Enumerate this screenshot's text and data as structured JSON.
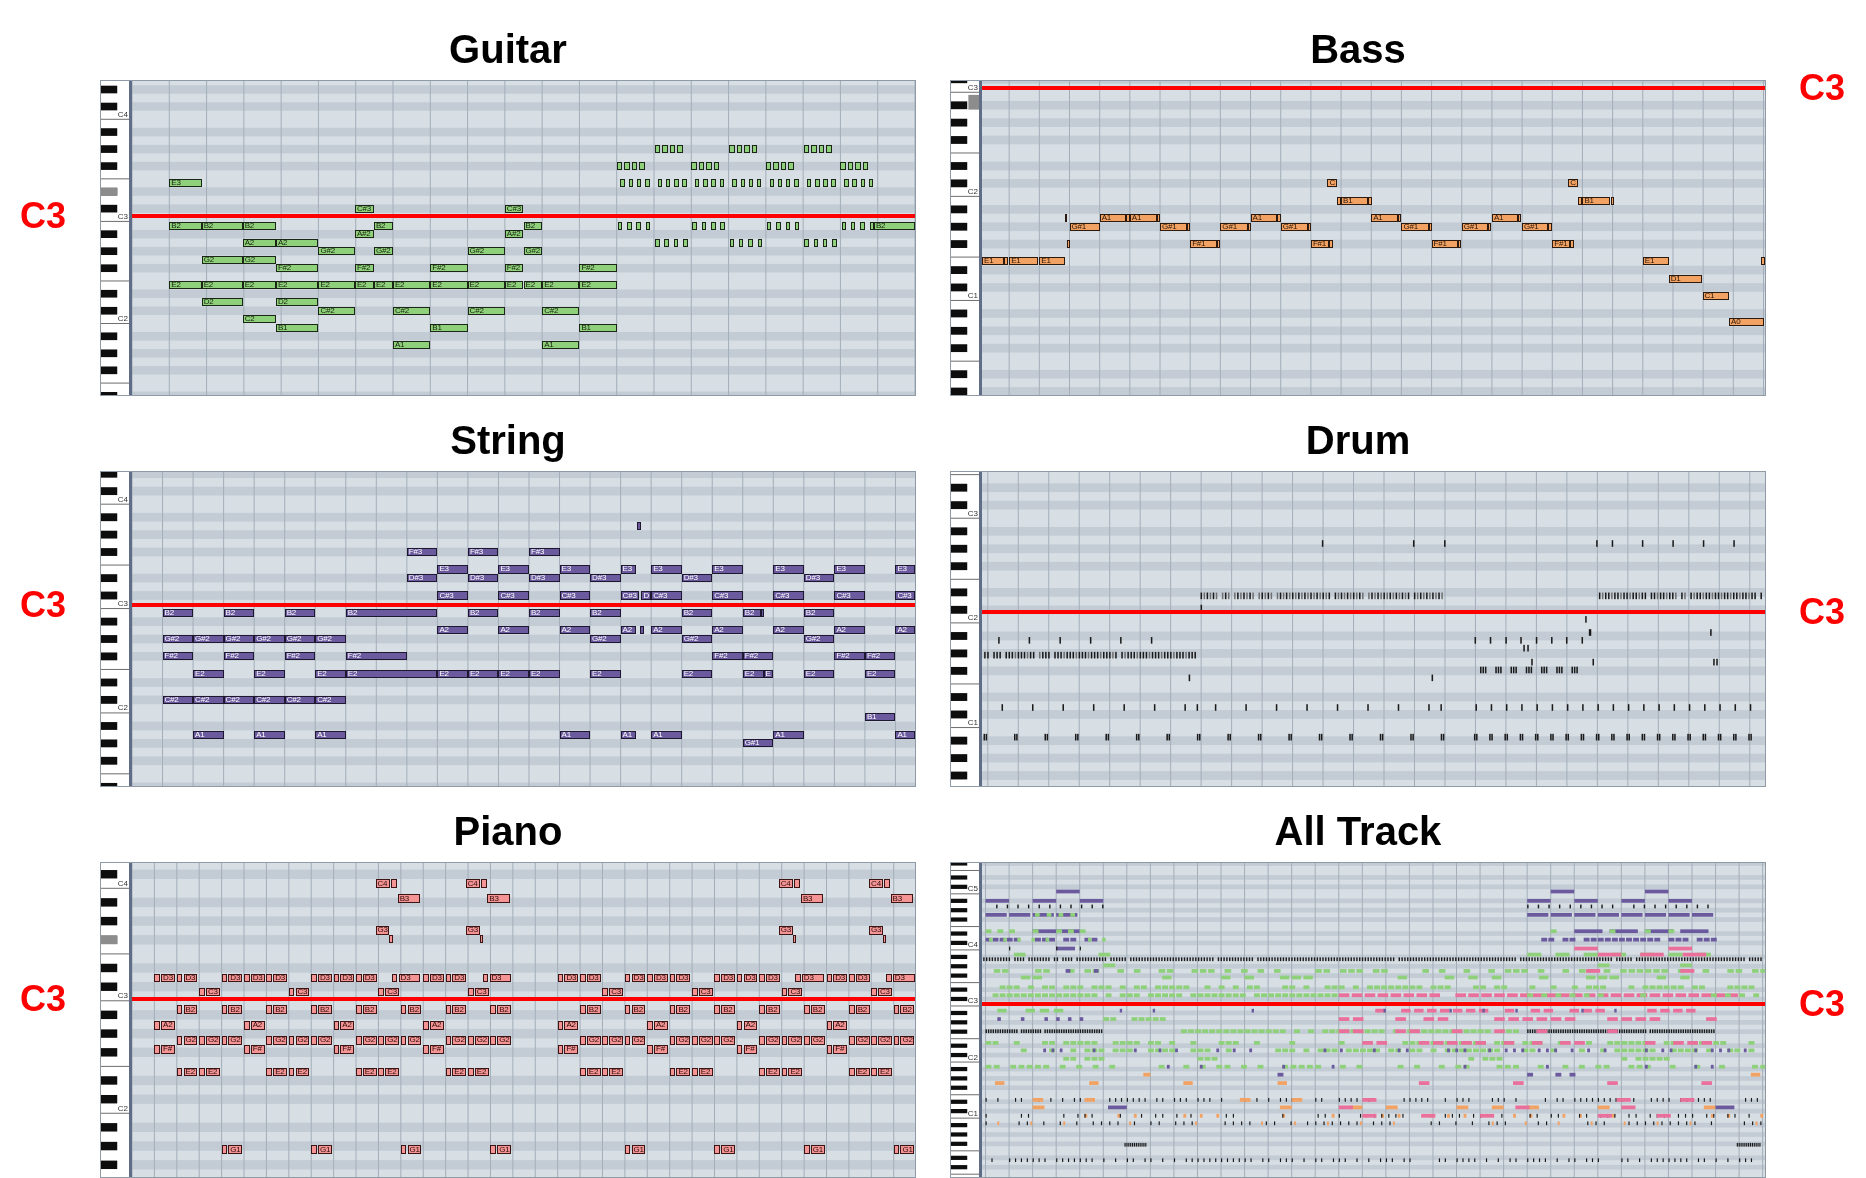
{
  "panels": [
    {
      "title": "Guitar",
      "marker": "C3",
      "octave_labels": [
        "C4",
        "C3",
        "C2"
      ],
      "note_rows": [
        {
          "notes": [
            "E3"
          ]
        },
        {
          "notes": [
            "C#3",
            "C#3"
          ]
        },
        {
          "notes": [
            "B2",
            "B2",
            "B2",
            "B2",
            "B2",
            "B2"
          ]
        },
        {
          "notes": [
            "A#2",
            "A#2"
          ]
        },
        {
          "notes": [
            "A2",
            "A2"
          ]
        },
        {
          "notes": [
            "G#2",
            "G#2",
            "G#2",
            "G#2"
          ]
        },
        {
          "notes": [
            "G2",
            "G2"
          ]
        },
        {
          "notes": [
            "F#2",
            "F#2",
            "F#2",
            "F#2",
            "F#2"
          ]
        },
        {
          "notes": [
            "E2",
            "E2",
            "E2",
            "E2",
            "E2",
            "E2",
            "E2",
            "E2",
            "E2",
            "E2",
            "E2",
            "E2",
            "E2",
            "E2"
          ]
        },
        {
          "notes": [
            "D2",
            "D2"
          ]
        },
        {
          "notes": [
            "C#2",
            "C#2",
            "C#2",
            "C#2"
          ]
        },
        {
          "notes": [
            "C2"
          ]
        },
        {
          "notes": [
            "B1",
            "B1",
            "B1"
          ]
        },
        {
          "notes": [
            "A1",
            "A1"
          ]
        }
      ]
    },
    {
      "title": "Bass",
      "marker": "C3",
      "octave_labels": [
        "C3",
        "C2",
        "C1"
      ],
      "note_rows": [
        {
          "notes": [
            "C",
            "C"
          ]
        },
        {
          "notes": [
            "B1",
            "B1"
          ]
        },
        {
          "notes": [
            "A1",
            "A1",
            "A1",
            "A1",
            "A1"
          ]
        },
        {
          "notes": [
            "G#1",
            "G#1",
            "G#1",
            "G#1",
            "G#1",
            "G#1",
            "G#1"
          ]
        },
        {
          "notes": [
            "F#1",
            "F#1",
            "F#1",
            "F#1"
          ]
        },
        {
          "notes": [
            "E1",
            "E1",
            "E1",
            "E1"
          ]
        },
        {
          "notes": [
            "D1"
          ]
        },
        {
          "notes": [
            "C1"
          ]
        },
        {
          "notes": [
            "A0"
          ]
        }
      ]
    },
    {
      "title": "String",
      "marker": "C3",
      "octave_labels": [
        "C4",
        "C3",
        "C2"
      ],
      "note_rows": [
        {
          "notes": [
            "F#3",
            "F#3",
            "F#3"
          ]
        },
        {
          "notes": [
            "E3",
            "E3",
            "E3",
            "E3",
            "E3",
            "E3",
            "E3",
            "E3",
            "E3"
          ]
        },
        {
          "notes": [
            "D#3",
            "D#3",
            "D#3",
            "D#3",
            "D#3",
            "D#3"
          ]
        },
        {
          "notes": [
            "C#3",
            "C#3",
            "C#3",
            "C#3",
            "D",
            "C#3",
            "C#3",
            "C#3",
            "C#3",
            "C#3"
          ]
        },
        {
          "notes": [
            "B2",
            "B2",
            "B2",
            "B2",
            "B2",
            "B2",
            "B2",
            "B2",
            "B2",
            "B2"
          ]
        },
        {
          "notes": [
            "A2",
            "A2",
            "A2",
            "A2",
            "A2",
            "A2",
            "A2",
            "A2",
            "A2"
          ]
        },
        {
          "notes": [
            "G#2",
            "G#2",
            "G#2",
            "G#2",
            "G#2",
            "G#2",
            "G#2",
            "G#2",
            "G#2"
          ]
        },
        {
          "notes": [
            "F#2",
            "F#2",
            "F#2",
            "F#2",
            "F#2",
            "F#2",
            "F#2",
            "F#2"
          ]
        },
        {
          "notes": [
            "E2",
            "E2",
            "E2",
            "E2",
            "E2",
            "E2",
            "E2",
            "E2",
            "E2",
            "E2",
            "E2",
            "E",
            "E2",
            "E2"
          ]
        },
        {
          "notes": [
            "C#2",
            "C#2",
            "C#2",
            "C#2",
            "C#2",
            "C#2"
          ]
        },
        {
          "notes": [
            "B1"
          ]
        },
        {
          "notes": [
            "A1",
            "A1",
            "A1",
            "A1",
            "A1",
            "A1",
            "A1",
            "A1"
          ]
        },
        {
          "notes": [
            "G#1"
          ]
        }
      ]
    },
    {
      "title": "Drum",
      "marker": "C3",
      "octave_labels": [
        "C3",
        "C2",
        "C1"
      ]
    },
    {
      "title": "Piano",
      "marker": "C3",
      "octave_labels": [
        "C4",
        "C3",
        "C2"
      ],
      "note_rows": [
        {
          "notes": [
            "C4",
            "C4",
            "C4",
            "C4"
          ]
        },
        {
          "notes": [
            "B3",
            "B3",
            "B3",
            "B3"
          ]
        },
        {
          "notes": [
            "G3",
            "G3",
            "G3",
            "G3"
          ]
        },
        {
          "notes": [
            "D3",
            "D3",
            "D3",
            "D3",
            "D3",
            "D3",
            "D3",
            "D3",
            "D3",
            "D3",
            "D3",
            "D3",
            "D3",
            "D3",
            "D3",
            "D3",
            "D3",
            "D3",
            "D3",
            "D3",
            "D3",
            "D3",
            "D3",
            "D3"
          ]
        },
        {
          "notes": [
            "C3",
            "C3",
            "C3",
            "C3",
            "C3",
            "C3",
            "C3",
            "C3"
          ]
        },
        {
          "notes": [
            "B2",
            "B2",
            "B2",
            "B2",
            "B2",
            "B2",
            "B2",
            "B2",
            "B2",
            "B2",
            "B2",
            "B2",
            "B2",
            "B2",
            "B2",
            "B2"
          ]
        },
        {
          "notes": [
            "A2",
            "A2",
            "A2",
            "A2",
            "A2",
            "A2",
            "A2",
            "A2"
          ]
        },
        {
          "notes": [
            "G2",
            "G2",
            "G2",
            "G2",
            "G2",
            "G2",
            "G2",
            "G2",
            "G2",
            "G2",
            "G2",
            "G2",
            "G2",
            "G2",
            "G2",
            "G2",
            "G2",
            "G2",
            "G2",
            "G2",
            "G2",
            "G2",
            "G2",
            "G2"
          ]
        },
        {
          "notes": [
            "F#",
            "F#",
            "F#",
            "F#",
            "F#",
            "F#",
            "F#",
            "F#"
          ]
        },
        {
          "notes": [
            "E2",
            "E2",
            "E2",
            "E2",
            "E2",
            "E2",
            "E2",
            "E2",
            "E2",
            "E2",
            "E2",
            "E2",
            "E2",
            "E2",
            "E2",
            "E2"
          ]
        },
        {
          "notes": [
            "G1",
            "G1",
            "G1",
            "G1",
            "G1",
            "G1",
            "G1",
            "G1"
          ]
        }
      ]
    },
    {
      "title": "All Track",
      "marker": "C3",
      "octave_labels": [
        "C5",
        "C4",
        "C3",
        "C2",
        "C1"
      ]
    }
  ]
}
